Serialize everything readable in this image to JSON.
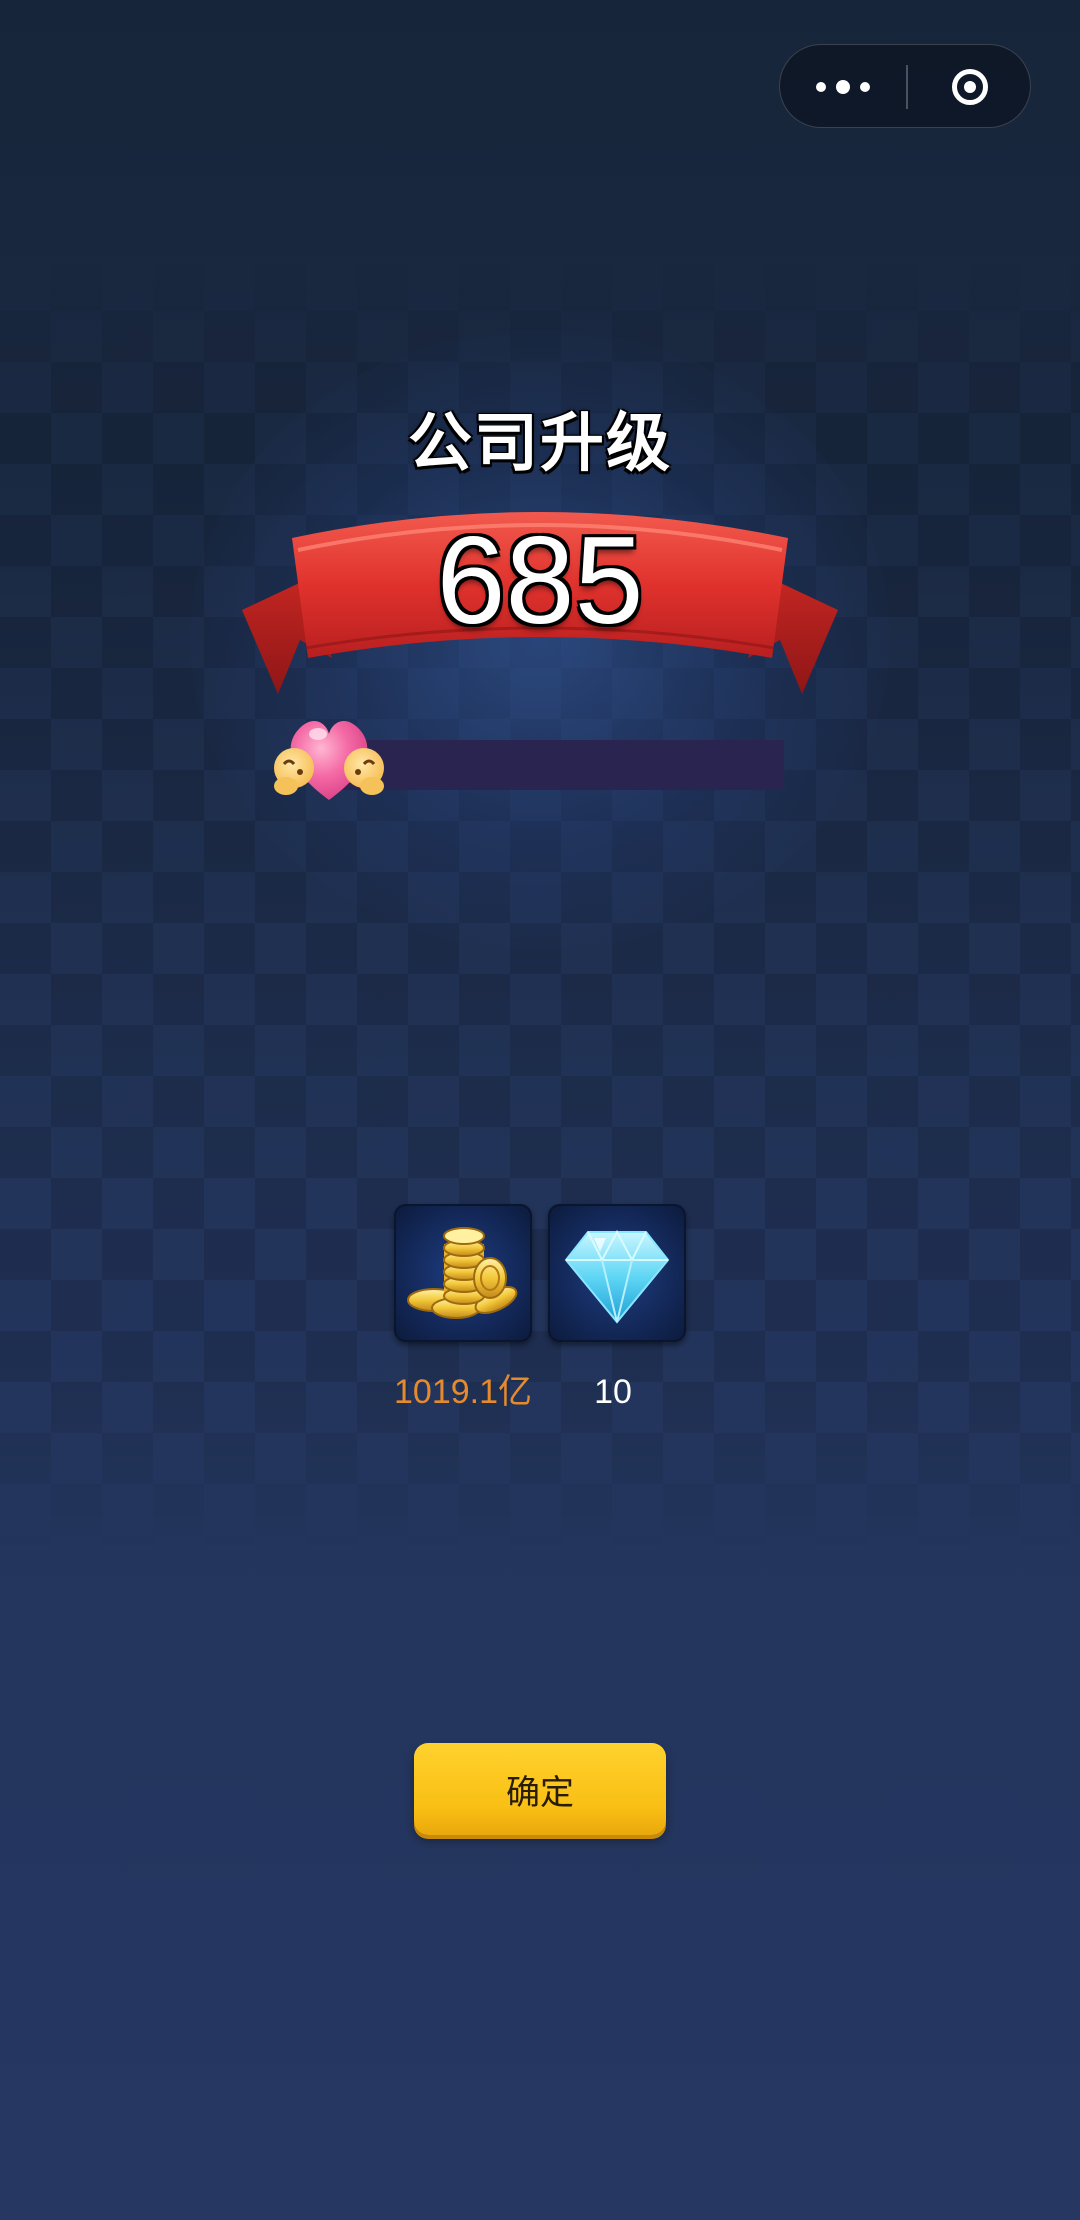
{
  "capsule": {
    "more_icon": "more-dots-icon",
    "close_icon": "target-circle-icon"
  },
  "dialog": {
    "title": "公司升级",
    "level": "685",
    "progress_fraction": 0,
    "avatar_icon": "heart-hands-emoji"
  },
  "rewards": [
    {
      "icon": "gold-coins-icon",
      "label": "1019.1亿",
      "color": "#e68a2e"
    },
    {
      "icon": "diamond-icon",
      "label": "10",
      "color": "#ffffff"
    }
  ],
  "confirm_button": {
    "label": "确定"
  },
  "colors": {
    "ribbon_red": "#e0322d",
    "button_yellow": "#fbc41a",
    "coin_text_orange": "#e68a2e"
  }
}
